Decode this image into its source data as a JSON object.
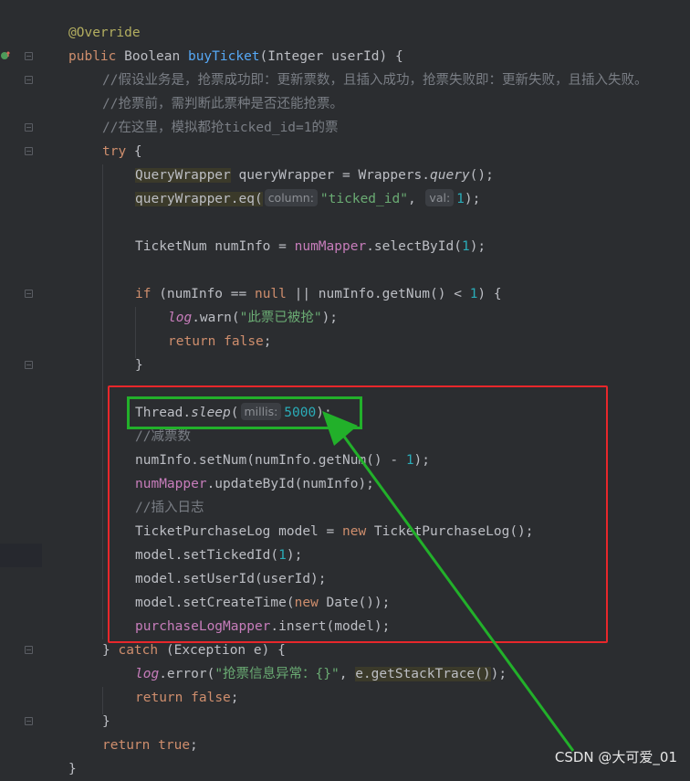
{
  "code": {
    "annotation": "@Override",
    "signature": {
      "kw_public": "public",
      "return_type": "Boolean",
      "method": "buyTicket",
      "params_open": "(Integer userId) {"
    },
    "comment_1": "//假设业务是，抢票成功即：更新票数，且插入成功，抢票失败即：更新失败，且插入失败。",
    "comment_2": "//抢票前，需判断此票种是否还能抢票。",
    "comment_3": "//在这里，模拟都抢ticked_id=1的票",
    "try_kw": "try",
    "try_brace": " {",
    "qw_type": "QueryWrapper",
    "qw_decl": " queryWrapper = Wrappers.",
    "qw_query": "query",
    "qw_end": "();",
    "eq_call": "queryWrapper.eq(",
    "hint_column": "column:",
    "eq_str": "\"ticked_id\"",
    "comma": ", ",
    "hint_val": "val:",
    "eq_num": "1",
    "eq_end": ");",
    "num_decl": "TicketNum numInfo = ",
    "num_mapper": "numMapper",
    "num_select": ".selectById(",
    "one": "1",
    "close_paren_semi": ");",
    "if_kw": "if",
    "if_cond_1": " (numInfo == ",
    "null_kw": "null",
    "if_cond_2": " || numInfo.getNum() < ",
    "if_cond_end": ") {",
    "log": "log",
    "warn": ".warn(",
    "warn_str": "\"此票已被抢\"",
    "return_kw": "return",
    "false_kw": "false",
    "true_kw": "true",
    "semi": ";",
    "close_brace": "}",
    "thread": "Thread.",
    "sleep": "sleep",
    "paren_open": "(",
    "hint_millis": "millis:",
    "sleep_ms": "5000",
    "comment_4": "//减票数",
    "setnum_1": "numInfo.setNum(numInfo.getNum() - ",
    "setnum_2": ");",
    "update_call": ".updateById(numInfo);",
    "comment_5": "//插入日志",
    "log_decl": "TicketPurchaseLog model = ",
    "new_kw": "new",
    "log_ctor": " TicketPurchaseLog();",
    "set_ticked": "model.setTickedId(",
    "set_user": "model.setUserId(userId);",
    "set_time_1": "model.setCreateTime(",
    "set_time_2": " Date());",
    "purchase_mapper": "purchaseLogMapper",
    "insert_call": ".insert(model);",
    "catch_open": "} ",
    "catch_kw": "catch",
    "catch_rest": " (Exception e) {",
    "error": ".error(",
    "error_str": "\"抢票信息异常：{}\"",
    "stack": "e.getStackTrace()",
    "stack_end": ");"
  },
  "watermark": "CSDN @大可爱_01",
  "colors": {
    "red_box": "#e8272b",
    "green_box": "#22b02a",
    "arrow": "#22b02a"
  }
}
